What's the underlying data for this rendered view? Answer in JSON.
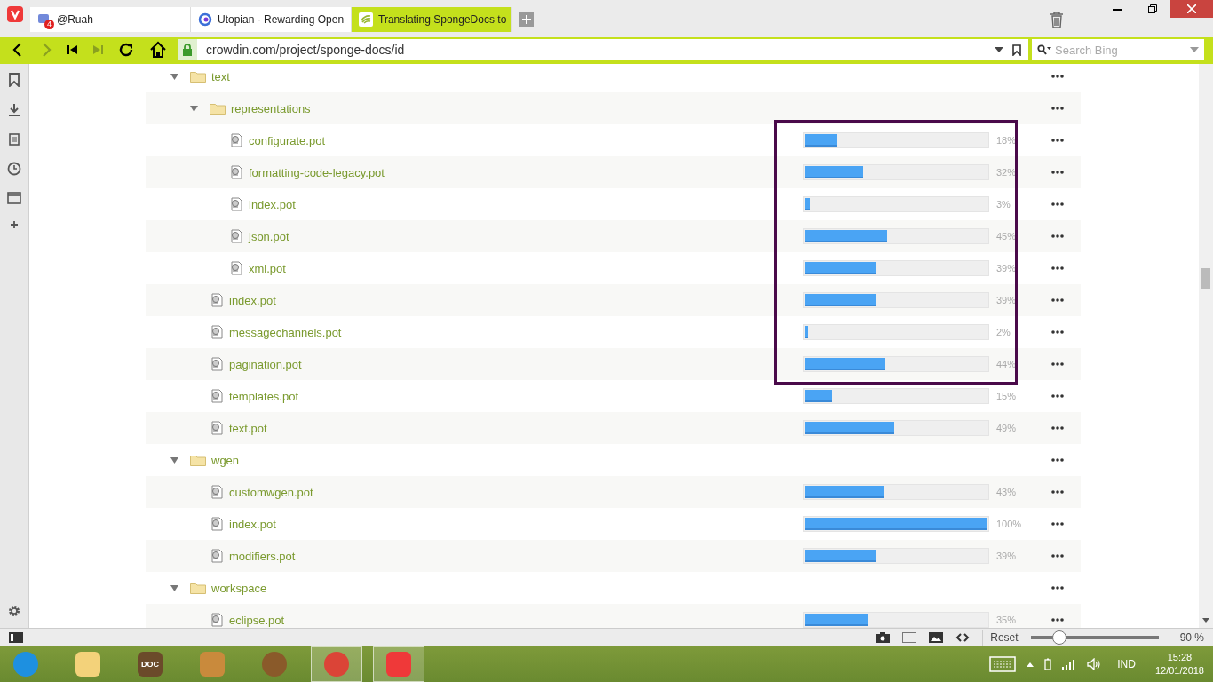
{
  "tabs": [
    {
      "title": "@Ruah",
      "badge": "4",
      "selected": false
    },
    {
      "title": "Utopian - Rewarding Open",
      "selected": false
    },
    {
      "title": "Translating SpongeDocs to",
      "selected": true
    }
  ],
  "address": {
    "url": "crowdin.com/project/sponge-docs/id",
    "secure": true
  },
  "search": {
    "placeholder": "Search Bing"
  },
  "tree": [
    {
      "kind": "folder",
      "name": "text",
      "expanded": true,
      "children": [
        {
          "kind": "folder",
          "name": "representations",
          "expanded": true,
          "children": [
            {
              "kind": "file",
              "name": "configurate.pot",
              "level": 0.18,
              "percent": "18%",
              "highlighted": true
            },
            {
              "kind": "file",
              "name": "formatting-code-legacy.pot",
              "level": 0.32,
              "percent": "32%",
              "highlighted": true
            },
            {
              "kind": "file",
              "name": "index.pot",
              "level": 0.03,
              "percent": "3%",
              "highlighted": true
            },
            {
              "kind": "file",
              "name": "json.pot",
              "level": 0.45,
              "percent": "45%",
              "highlighted": true
            },
            {
              "kind": "file",
              "name": "xml.pot",
              "level": 0.39,
              "percent": "39%",
              "highlighted": true
            }
          ]
        },
        {
          "kind": "file",
          "name": "index.pot",
          "level": 0.39,
          "percent": "39%",
          "highlighted": true
        },
        {
          "kind": "file",
          "name": "messagechannels.pot",
          "level": 0.02,
          "percent": "2%",
          "highlighted": true
        },
        {
          "kind": "file",
          "name": "pagination.pot",
          "level": 0.44,
          "percent": "44%",
          "highlighted": true
        },
        {
          "kind": "file",
          "name": "templates.pot",
          "level": 0.15,
          "percent": "15%",
          "highlighted": false
        },
        {
          "kind": "file",
          "name": "text.pot",
          "level": 0.49,
          "percent": "49%",
          "highlighted": false
        }
      ]
    },
    {
      "kind": "folder",
      "name": "wgen",
      "expanded": true,
      "children": [
        {
          "kind": "file",
          "name": "customwgen.pot",
          "level": 0.43,
          "percent": "43%",
          "highlighted": false
        },
        {
          "kind": "file",
          "name": "index.pot",
          "level": 1.0,
          "percent": "100%",
          "highlighted": false
        },
        {
          "kind": "file",
          "name": "modifiers.pot",
          "level": 0.39,
          "percent": "39%",
          "highlighted": false
        }
      ]
    },
    {
      "kind": "folder",
      "name": "workspace",
      "expanded": true,
      "children": [
        {
          "kind": "file",
          "name": "eclipse.pot",
          "level": 0.35,
          "percent": "35%",
          "highlighted": false
        }
      ]
    }
  ],
  "status_bar": {
    "reset": "Reset",
    "zoom": {
      "level": 0.17
    },
    "zoom_reading": "90 %"
  },
  "taskbar": {
    "apps": [
      {
        "kind": "ie",
        "running": false
      },
      {
        "kind": "folder",
        "running": false
      },
      {
        "kind": "doc",
        "label": "DOC",
        "running": false
      },
      {
        "kind": "photo",
        "running": false
      },
      {
        "kind": "speaker",
        "running": false
      },
      {
        "kind": "chrome",
        "running": true
      },
      {
        "kind": "vivaldi",
        "running": true
      }
    ],
    "language": "IND",
    "time": "15:28",
    "date": "12/01/2018"
  }
}
